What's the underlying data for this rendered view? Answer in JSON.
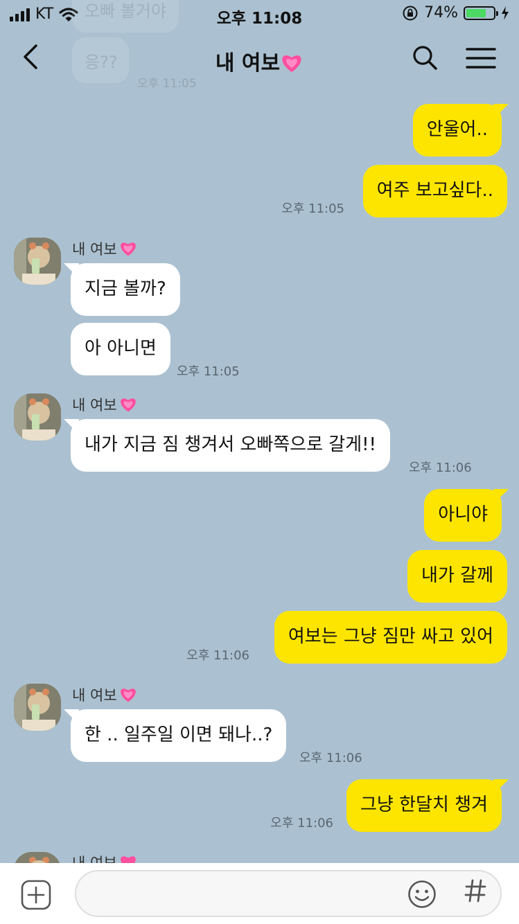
{
  "status": {
    "carrier": "KT",
    "time": "오후 11:08",
    "battery": "74%",
    "battery_level": 0.74
  },
  "header": {
    "title": "내 여보"
  },
  "ghost": {
    "top_text": "오빠 볼거야",
    "msg": "응??",
    "time": "오후 11:05"
  },
  "messages": {
    "m1": "안울어..",
    "m2": "여주 보고싶다..",
    "m2_time": "오후 11:05",
    "g1_sender": "내 여보",
    "m3": "지금 볼까?",
    "m4": "아 아니면",
    "m4_time": "오후 11:05",
    "g2_sender": "내 여보",
    "m5": "내가 지금 짐 챙겨서 오빠쪽으로 갈게!!",
    "m5_time": "오후 11:06",
    "m6": "아니야",
    "m7": "내가 갈께",
    "m8": "여보는 그냥 짐만 싸고 있어",
    "m8_time": "오후 11:06",
    "g3_sender": "내 여보",
    "m9": "한 .. 일주일 이면 돼나..?",
    "m9_time": "오후 11:06",
    "m10": "그냥 한달치 챙겨",
    "m10_time": "오후 11:06",
    "g4_sender": "내 여보"
  },
  "colors": {
    "background": "#abc1d1",
    "my_bubble": "#fee500",
    "their_bubble": "#ffffff",
    "heart": "#ff4fa0"
  }
}
